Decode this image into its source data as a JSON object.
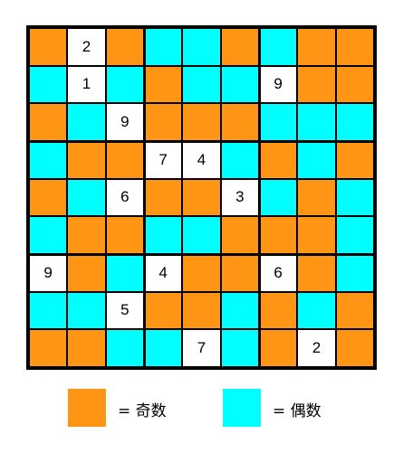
{
  "colors": {
    "odd": "#ff9515",
    "even": "#00ffff",
    "given": "#ffffff"
  },
  "grid": [
    [
      "O",
      "2",
      "O",
      "E",
      "E",
      "O",
      "E",
      "O",
      "O"
    ],
    [
      "E",
      "1",
      "E",
      "O",
      "E",
      "E",
      "9",
      "O",
      "O"
    ],
    [
      "O",
      "E",
      "9",
      "O",
      "O",
      "O",
      "E",
      "E",
      "E"
    ],
    [
      "E",
      "O",
      "O",
      "7",
      "4",
      "E",
      "O",
      "E",
      "O"
    ],
    [
      "O",
      "E",
      "6",
      "O",
      "O",
      "3",
      "E",
      "O",
      "E"
    ],
    [
      "E",
      "O",
      "O",
      "E",
      "E",
      "O",
      "O",
      "O",
      "E"
    ],
    [
      "9",
      "O",
      "E",
      "4",
      "O",
      "O",
      "6",
      "O",
      "E"
    ],
    [
      "E",
      "E",
      "5",
      "O",
      "O",
      "E",
      "O",
      "E",
      "O"
    ],
    [
      "O",
      "O",
      "E",
      "E",
      "7",
      "E",
      "O",
      "2",
      "O"
    ]
  ],
  "legend": {
    "odd_label": "= 奇数",
    "even_label": "= 偶数"
  }
}
